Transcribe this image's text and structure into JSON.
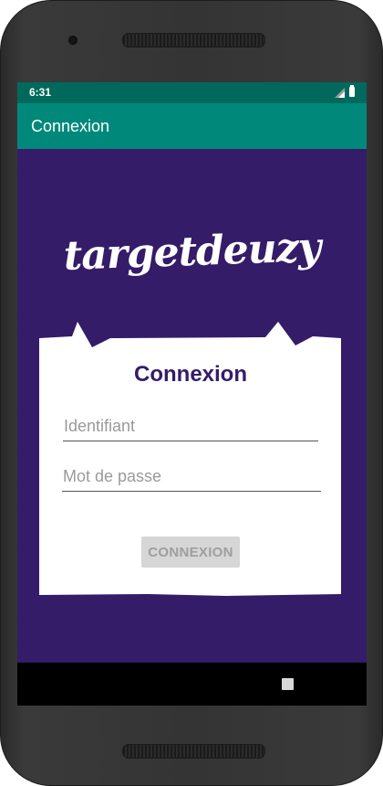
{
  "status": {
    "time": "6:31"
  },
  "appbar": {
    "title": "Connexion"
  },
  "logo": {
    "text": "targetdeuzy"
  },
  "login": {
    "title": "Connexion",
    "username_placeholder": "Identifiant",
    "password_placeholder": "Mot de passe",
    "submit_label": "CONNEXION"
  },
  "colors": {
    "background": "#341c69",
    "statusbar": "#00695c",
    "appbar": "#00897b",
    "title_text": "#341c69",
    "button_disabled": "#d6d6d6"
  },
  "icons": [
    "signal-icon",
    "battery-icon",
    "recent-apps-icon"
  ]
}
